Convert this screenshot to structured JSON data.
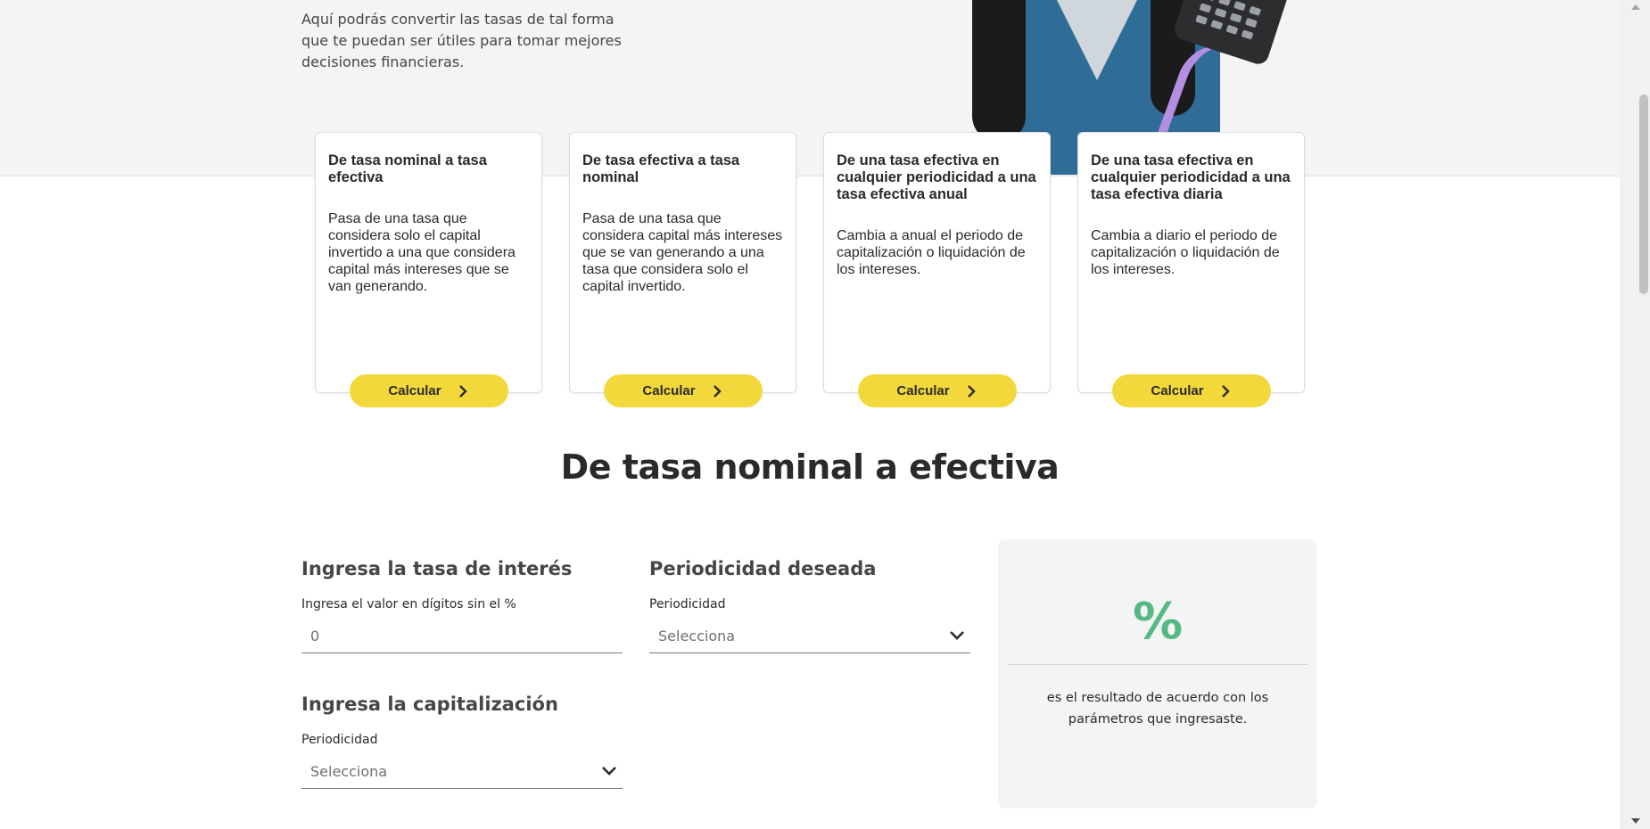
{
  "hero": {
    "text": "Aquí podrás convertir las tasas de tal forma que te puedan ser útiles para tomar mejores decisiones financieras."
  },
  "cards": [
    {
      "title": "De tasa nominal a tasa efectiva",
      "description": "Pasa de una tasa que considera solo el capital invertido a una que considera capital más intereses que se van generando.",
      "button": "Calcular"
    },
    {
      "title": "De tasa efectiva a tasa nominal",
      "description": "Pasa de una tasa que considera capital más intereses que se van generando a una tasa que considera solo el capital invertido.",
      "button": "Calcular"
    },
    {
      "title": "De una tasa efectiva en cualquier periodicidad a una tasa efectiva anual",
      "description": "Cambia a anual el periodo de capitalización o liquidación de los intereses.",
      "button": "Calcular"
    },
    {
      "title": "De una tasa efectiva en cualquier periodicidad a una tasa efectiva diaria",
      "description": "Cambia a diario el periodo de capitalización o liquidación de los intereses.",
      "button": "Calcular"
    }
  ],
  "calculator": {
    "title": "De tasa nominal a efectiva",
    "rate": {
      "heading": "Ingresa la tasa de interés",
      "label": "Ingresa el valor en dígitos sin el %",
      "placeholder": "0"
    },
    "desired": {
      "heading": "Periodicidad deseada",
      "label": "Periodicidad",
      "value": "Selecciona"
    },
    "capitalization": {
      "heading": "Ingresa la capitalización",
      "label": "Periodicidad",
      "value": "Selecciona"
    },
    "result": {
      "symbol": "%",
      "description": "es el resultado de acuerdo con los parámetros que ingresaste."
    }
  },
  "colors": {
    "accent": "#f2d83b",
    "result": "#54b982",
    "text": "#2c2a29"
  },
  "icons": {
    "button": "chevron-right-icon",
    "select": "chevron-down-icon"
  }
}
